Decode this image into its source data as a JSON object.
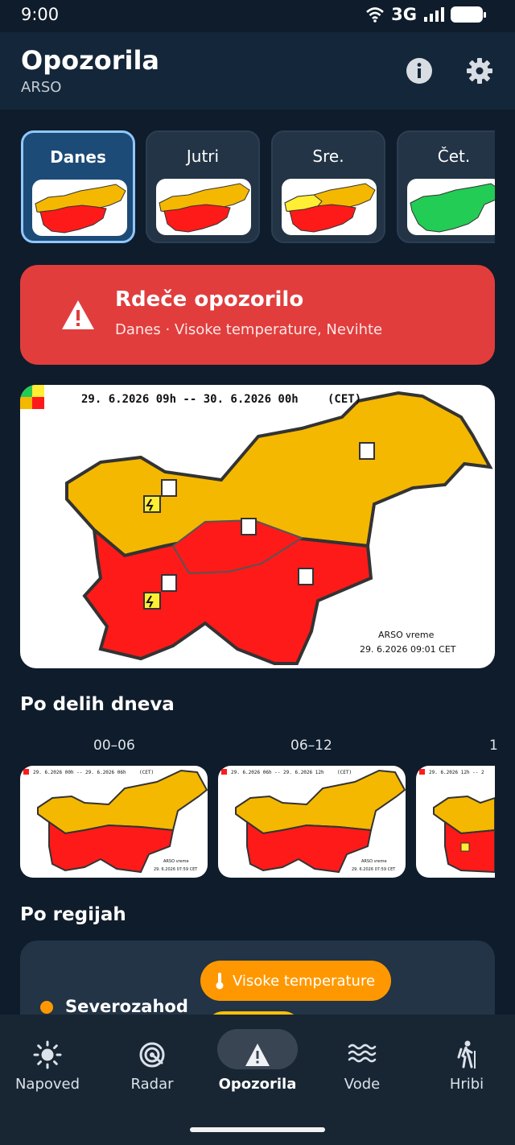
{
  "status": {
    "time": "9:00",
    "network": "3G"
  },
  "header": {
    "title": "Opozorila",
    "subtitle": "ARSO"
  },
  "days": [
    {
      "label": "Danes",
      "active": true
    },
    {
      "label": "Jutri",
      "active": false
    },
    {
      "label": "Sre.",
      "active": false
    },
    {
      "label": "Čet.",
      "active": false
    }
  ],
  "alert": {
    "title": "Rdeče opozorilo",
    "subtitle": "Danes · Visoke temperature, Nevihte"
  },
  "map": {
    "period": "29. 6.2026 09h -- 30. 6.2026 00h",
    "timezone": "(CET)",
    "source": "ARSO vreme",
    "issued": "29. 6.2026 09:01 CET"
  },
  "sections": {
    "parts_of_day": "Po delih dneva",
    "regions": "Po regijah"
  },
  "periods": [
    {
      "label": "00–06",
      "map_period": "29. 6.2026 00h -- 29. 6.2026 06h",
      "tz": "(CET)",
      "source": "ARSO vreme",
      "issued": "29. 6.2026 07:59 CET"
    },
    {
      "label": "06–12",
      "map_period": "29. 6.2026 06h -- 29. 6.2026 12h",
      "tz": "(CET)",
      "source": "ARSO vreme",
      "issued": "29. 6.2026 07:59 CET"
    },
    {
      "label": "1",
      "map_period": "29. 6.2026 12h -- 2",
      "tz": "",
      "source": "",
      "issued": ""
    }
  ],
  "region": {
    "name": "Severozahod",
    "chip": "Visoke temperature"
  },
  "nav": [
    {
      "label": "Napoved",
      "icon": "sun-icon",
      "active": false
    },
    {
      "label": "Radar",
      "icon": "radar-icon",
      "active": false
    },
    {
      "label": "Opozorila",
      "icon": "warning-icon",
      "active": true
    },
    {
      "label": "Vode",
      "icon": "waves-icon",
      "active": false
    },
    {
      "label": "Hribi",
      "icon": "hiker-icon",
      "active": false
    }
  ],
  "colors": {
    "background": "#0f1c2b",
    "red_alert": "#e13d3d",
    "orange": "#f5b800",
    "red": "#ff1a1a",
    "yellow": "#ffee33",
    "green": "#22cc55",
    "chip_orange": "#ff9800"
  }
}
